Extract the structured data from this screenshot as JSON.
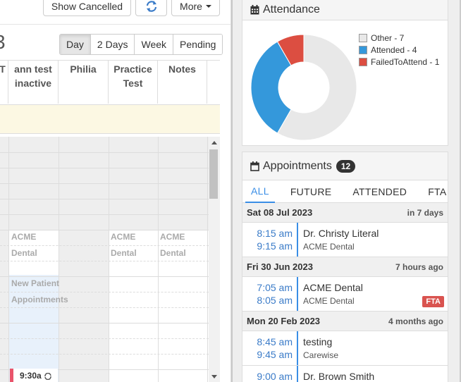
{
  "toolbar": {
    "show_cancelled": "Show Cancelled",
    "more": "More"
  },
  "calendar": {
    "title_fragment": "3",
    "views": [
      "Day",
      "2 Days",
      "Week",
      "Pending"
    ],
    "active_view": "Day",
    "columns": [
      {
        "lines": [
          "T",
          ""
        ]
      },
      {
        "lines": [
          "ann test",
          "inactive"
        ]
      },
      {
        "lines": [
          "Philia",
          ""
        ]
      },
      {
        "lines": [
          "Practice",
          "Test"
        ]
      },
      {
        "lines": [
          "Notes",
          ""
        ]
      }
    ],
    "cells": {
      "acme_1": "ACME",
      "dental_1": "Dental",
      "acme_3": "ACME",
      "dental_3": "Dental",
      "acme_4": "ACME",
      "dental_4": "Dental",
      "new_patient": "New Patient",
      "appointments": "Appointments"
    },
    "appointment_chip": "9:30a"
  },
  "attendance": {
    "title": "Attendance",
    "legend": [
      {
        "label": "Other - 7",
        "color": "#e8e8e8"
      },
      {
        "label": "Attended - 4",
        "color": "#3498db"
      },
      {
        "label": "FailedToAttend - 1",
        "color": "#dc4e41"
      }
    ],
    "chart_data": {
      "type": "pie",
      "categories": [
        "Other",
        "Attended",
        "FailedToAttend"
      ],
      "values": [
        7,
        4,
        1
      ],
      "colors": [
        "#e8e8e8",
        "#3498db",
        "#dc4e41"
      ],
      "donut": true
    }
  },
  "appointments": {
    "title": "Appointments",
    "count": "12",
    "tabs": [
      "ALL",
      "FUTURE",
      "ATTENDED",
      "FTA"
    ],
    "active_tab": "ALL",
    "groups": [
      {
        "date": "Sat 08 Jul 2023",
        "relative": "in 7 days",
        "items": [
          {
            "start": "8:15 am",
            "end": "9:15 am",
            "title": "Dr. Christy Literal",
            "sub": "ACME Dental",
            "badge": ""
          }
        ]
      },
      {
        "date": "Fri 30 Jun 2023",
        "relative": "7 hours ago",
        "items": [
          {
            "start": "7:05 am",
            "end": "8:05 am",
            "title": "ACME Dental",
            "sub": "ACME Dental",
            "badge": "FTA"
          }
        ]
      },
      {
        "date": "Mon 20 Feb 2023",
        "relative": "4 months ago",
        "items": [
          {
            "start": "8:45 am",
            "end": "9:45 am",
            "title": "testing",
            "sub": "Carewise",
            "badge": ""
          },
          {
            "start": "9:00 am",
            "end": "",
            "title": "Dr. Brown Smith",
            "sub": "",
            "badge": ""
          }
        ]
      }
    ]
  }
}
